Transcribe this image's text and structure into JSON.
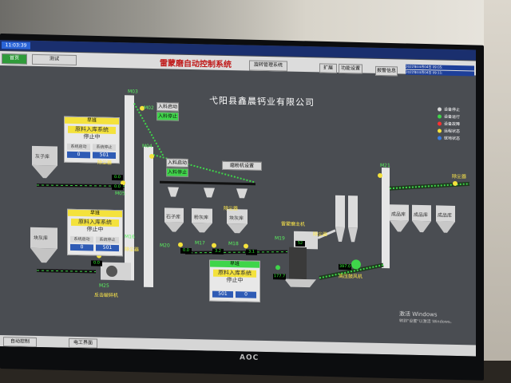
{
  "header": {
    "time": "11:03:39",
    "title": "雷蒙磨自动控制系统",
    "left_btn": "测试",
    "btn_right_1": "旋转管理系统",
    "btn_right_2": "扩展",
    "btn_right_3": "功能设置",
    "btn_right_4": "报警信息",
    "datetime_1": "2022年03月04日 09:05:",
    "datetime_2": "2022年03月04日 09:11:"
  },
  "company": "弋阳县鑫晨钙业有限公司",
  "legend": {
    "items": [
      "设备停止",
      "设备运行",
      "设备故障",
      "远程状态",
      "就地状态"
    ],
    "colors": [
      "#d8d8d8",
      "#3fd54a",
      "#ff3030",
      "#f4e23c",
      "#3a7be0"
    ]
  },
  "panel1": {
    "header": "早班",
    "title": "原料入库系统",
    "status": "停止中",
    "mode_a": "系统启动",
    "mode_b": "系统停止",
    "count_a": "0",
    "count_b": "501"
  },
  "panel2": {
    "header": "早班",
    "title": "原料入库系统",
    "status": "停止中",
    "mode_a": "系统启动",
    "mode_b": "系统停止",
    "count_a": "0",
    "count_b": "501"
  },
  "panel3": {
    "header": "早班",
    "title": "原料入库系统",
    "status": "停止中",
    "count_a": "501",
    "count_b": "0"
  },
  "silos": {
    "s1": "灰子库",
    "s2": "块灰库",
    "s3": "石子库",
    "s4": "粉灰库",
    "s5": "块灰库",
    "f1": "成品库",
    "f2": "成品库",
    "f3": "成品库"
  },
  "labels": {
    "dust1": "除尘器",
    "dust2": "除尘器",
    "dust3": "除尘器",
    "dust4": "除尘器",
    "dust5": "除尘器",
    "fan_main": "雷蒙磨主机",
    "crusher": "反击破碎机",
    "fan2": "高压鼓风机",
    "m03": "M03",
    "m04": "M04",
    "m02": "M02",
    "m05": "M05",
    "m16": "M16",
    "m25": "M25",
    "m17": "M17",
    "m18": "M18",
    "m20": "M20",
    "m21": "M21",
    "m19": "M19"
  },
  "controls": {
    "b1": "入料启动",
    "b2": "入料停止",
    "b3": "入料启动",
    "b4": "入料停止",
    "b5": "磨粉机设置"
  },
  "values": {
    "v1": "0.0",
    "v2": "0.0",
    "v3": "3.2",
    "v4": "3.1",
    "v5": "0.0",
    "v6": "52",
    "v7": "177.7",
    "v8": "397.0",
    "v9": "0.0"
  },
  "footer": {
    "auto_btn": "自动控制",
    "manual_btn": "电工界面"
  },
  "watermark": {
    "line1": "激活 Windows",
    "line2": "转到\"设置\"以激活 Windows。"
  },
  "brand": "AOC"
}
